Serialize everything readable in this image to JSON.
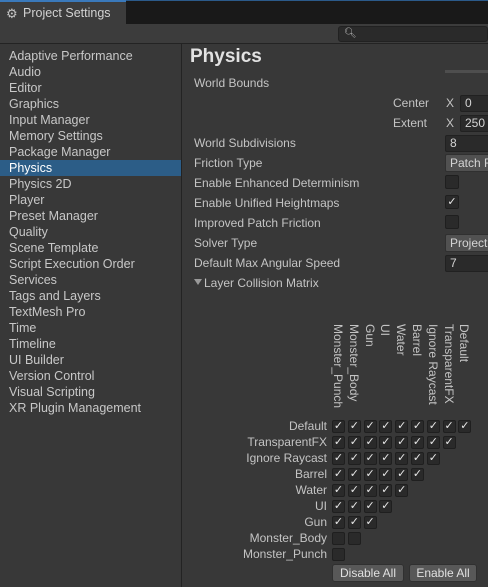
{
  "window": {
    "title": "Project Settings",
    "icon": "gear-icon"
  },
  "search": {
    "placeholder": ""
  },
  "sidebar": {
    "items": [
      "Adaptive Performance",
      "Audio",
      "Editor",
      "Graphics",
      "Input Manager",
      "Memory Settings",
      "Package Manager",
      "Physics",
      "Physics 2D",
      "Player",
      "Preset Manager",
      "Quality",
      "Scene Template",
      "Script Execution Order",
      "Services",
      "Tags and Layers",
      "TextMesh Pro",
      "Time",
      "Timeline",
      "UI Builder",
      "Version Control",
      "Visual Scripting",
      "XR Plugin Management"
    ],
    "selected": "Physics"
  },
  "physics": {
    "title": "Physics",
    "world_bounds_label": "World Bounds",
    "center_label": "Center",
    "center_x_axis": "X",
    "center_x_value": "0",
    "extent_label": "Extent",
    "extent_x_axis": "X",
    "extent_x_value": "250",
    "world_subdivisions_label": "World Subdivisions",
    "world_subdivisions_value": "8",
    "friction_type_label": "Friction Type",
    "friction_type_value": "Patch F",
    "enhanced_determinism_label": "Enable Enhanced Determinism",
    "enhanced_determinism_checked": false,
    "unified_heightmaps_label": "Enable Unified Heightmaps",
    "unified_heightmaps_checked": true,
    "improved_patch_friction_label": "Improved Patch Friction",
    "improved_patch_friction_checked": false,
    "solver_type_label": "Solver Type",
    "solver_type_value": "Project",
    "max_angular_speed_label": "Default Max Angular Speed",
    "max_angular_speed_value": "7",
    "collision_matrix_label": "Layer Collision Matrix"
  },
  "matrix": {
    "layers": [
      "Default",
      "TransparentFX",
      "Ignore Raycast",
      "Barrel",
      "Water",
      "UI",
      "Gun",
      "Monster_Body",
      "Monster_Punch"
    ],
    "columns": [
      "Monster_Punch",
      "Monster_Body",
      "Gun",
      "UI",
      "Water",
      "Barrel",
      "Ignore Raycast",
      "TransparentFX",
      "Default"
    ],
    "checked": [
      [
        true,
        true,
        true,
        true,
        true,
        true,
        true,
        true,
        true
      ],
      [
        true,
        true,
        true,
        true,
        true,
        true,
        true,
        true
      ],
      [
        true,
        true,
        true,
        true,
        true,
        true,
        true
      ],
      [
        true,
        true,
        true,
        true,
        true,
        true
      ],
      [
        true,
        true,
        true,
        true,
        true
      ],
      [
        true,
        true,
        true,
        true
      ],
      [
        true,
        true,
        true
      ],
      [
        false,
        false
      ],
      [
        false
      ]
    ],
    "disable_all_label": "Disable All",
    "enable_all_label": "Enable All"
  }
}
